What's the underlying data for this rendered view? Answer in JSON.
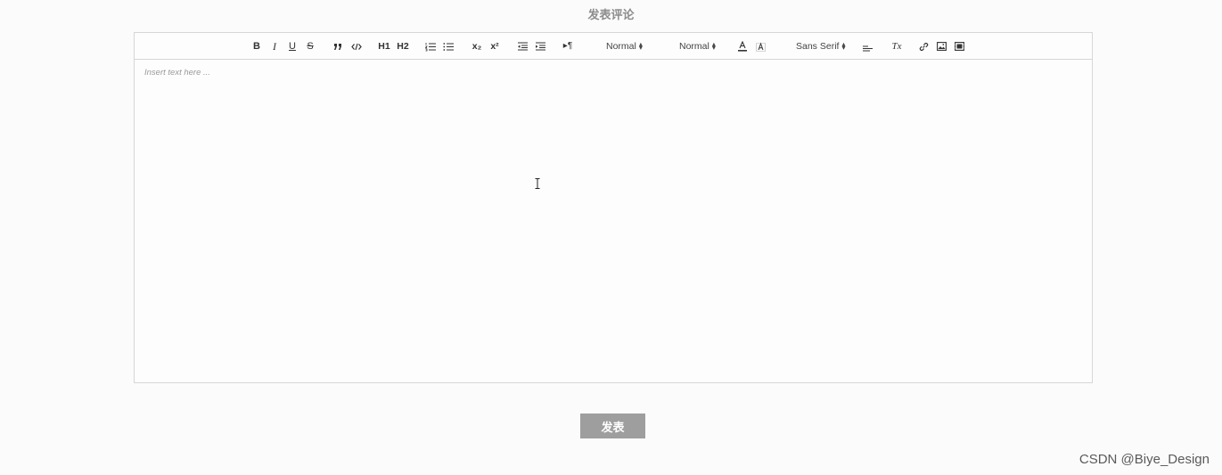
{
  "page": {
    "title": "发表评论",
    "submit_label": "发表",
    "watermark": "CSDN @Biye_Design"
  },
  "editor": {
    "placeholder": "Insert text here ...",
    "toolbar": {
      "bold": "B",
      "italic": "I",
      "underline": "U",
      "strike": "S",
      "header1": "H1",
      "header2": "H2",
      "subscript": "x₂",
      "superscript": "x²",
      "direction": "▸¶",
      "size_picker": "Normal",
      "header_picker": "Normal",
      "font_picker": "Sans Serif",
      "clean": "Tx",
      "icons": [
        "bold-icon",
        "italic-icon",
        "underline-icon",
        "strike-icon",
        "blockquote-icon",
        "code-block-icon",
        "header1-icon",
        "header2-icon",
        "ordered-list-icon",
        "bullet-list-icon",
        "subscript-icon",
        "superscript-icon",
        "outdent-icon",
        "indent-icon",
        "direction-icon",
        "color-icon",
        "background-icon",
        "align-icon",
        "clean-icon",
        "link-icon",
        "image-icon",
        "video-icon"
      ]
    }
  },
  "colors": {
    "button_bg": "#9e9e9e",
    "border": "#d6d6d6",
    "title": "#8c8c8c"
  }
}
